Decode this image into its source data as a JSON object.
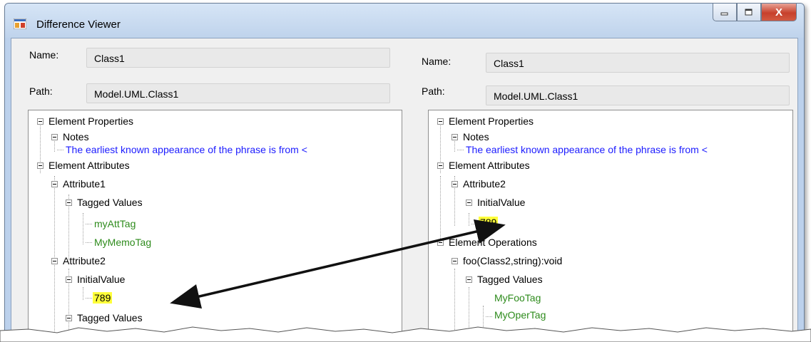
{
  "window": {
    "title": "Difference Viewer",
    "close_glyph": "X"
  },
  "left": {
    "name_label": "Name:",
    "name_value": "Class1",
    "path_label": "Path:",
    "path_value": "Model.UML.Class1",
    "tree": {
      "element_properties": "Element Properties",
      "notes": "Notes",
      "notes_text": "The earliest known appearance of the phrase is from <",
      "element_attributes": "Element Attributes",
      "attribute1": "Attribute1",
      "tagged_values_1": "Tagged Values",
      "my_att_tag": "myAttTag",
      "my_memo_tag": "MyMemoTag",
      "attribute2": "Attribute2",
      "initial_value": "InitialValue",
      "value": "789",
      "tagged_values_2": "Tagged Values"
    }
  },
  "right": {
    "name_label": "Name:",
    "name_value": "Class1",
    "path_label": "Path:",
    "path_value": "Model.UML.Class1",
    "tree": {
      "element_properties": "Element Properties",
      "notes": "Notes",
      "notes_text": "The earliest known appearance of the phrase is from <",
      "element_attributes": "Element Attributes",
      "attribute2": "Attribute2",
      "initial_value": "InitialValue",
      "value": "789",
      "element_operations": "Element Operations",
      "operation": "foo(Class2,string):void",
      "tagged_values": "Tagged Values",
      "my_foo_tag": "MyFooTag",
      "my_oper_tag": "MyOperTag"
    }
  },
  "colors": {
    "changed_text": "#1c1cff",
    "tag_text": "#2e8b1c",
    "highlight": "#ffff3a"
  }
}
